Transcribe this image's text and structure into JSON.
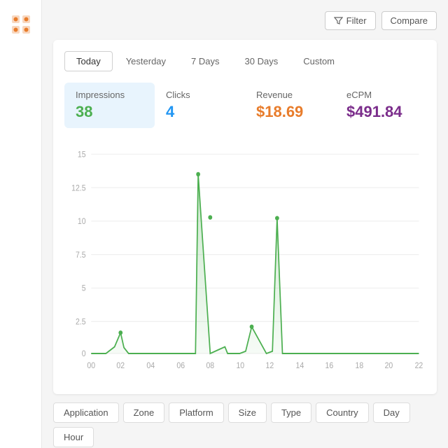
{
  "sidebar": {
    "logo": "grid-icon"
  },
  "topBar": {
    "filter_label": "Filter",
    "compare_label": "Compare"
  },
  "dateTabs": [
    {
      "label": "Today",
      "active": true
    },
    {
      "label": "Yesterday",
      "active": false
    },
    {
      "label": "7 Days",
      "active": false
    },
    {
      "label": "30 Days",
      "active": false
    },
    {
      "label": "Custom",
      "active": false
    }
  ],
  "metrics": [
    {
      "label": "Impressions",
      "value": "38",
      "color": "green",
      "highlight": true
    },
    {
      "label": "Clicks",
      "value": "4",
      "color": "blue",
      "highlight": false
    },
    {
      "label": "Revenue",
      "value": "$18.69",
      "color": "orange",
      "highlight": false
    },
    {
      "label": "eCPM",
      "value": "$491.84",
      "color": "purple",
      "highlight": false
    }
  ],
  "chart": {
    "yLabels": [
      "15",
      "12.5",
      "10",
      "7.5",
      "5",
      "2.5",
      "0"
    ],
    "xLabels": [
      "00",
      "02",
      "04",
      "06",
      "08",
      "10",
      "12",
      "14",
      "16",
      "18",
      "20",
      "22"
    ]
  },
  "filterTabs": [
    {
      "label": "Application"
    },
    {
      "label": "Zone"
    },
    {
      "label": "Platform"
    },
    {
      "label": "Size"
    },
    {
      "label": "Type"
    },
    {
      "label": "Country"
    },
    {
      "label": "Day"
    },
    {
      "label": "Hour"
    }
  ]
}
